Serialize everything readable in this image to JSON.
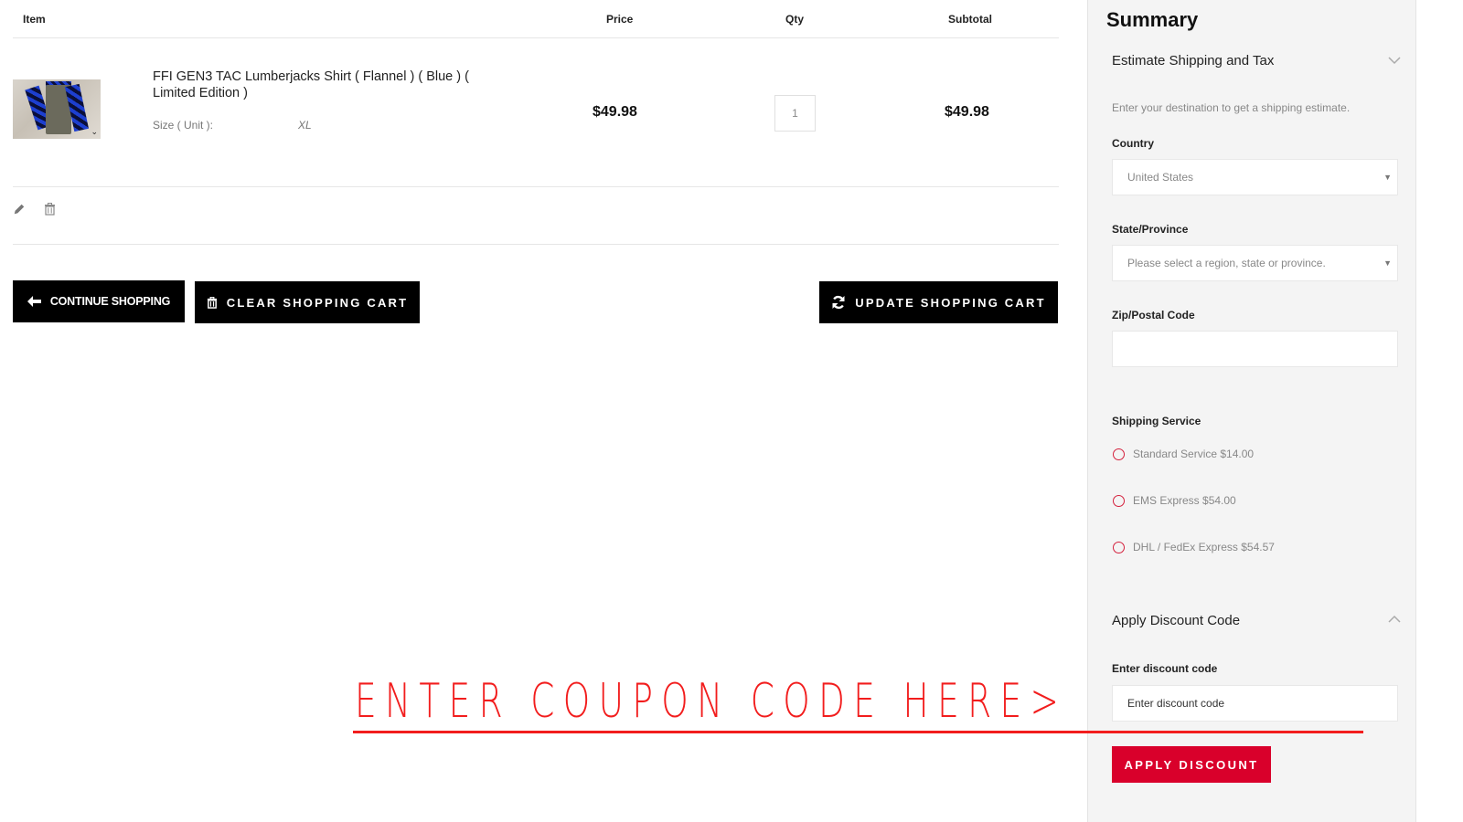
{
  "cart": {
    "headers": {
      "item": "Item",
      "price": "Price",
      "qty": "Qty",
      "subtotal": "Subtotal"
    },
    "items": [
      {
        "name": "FFI GEN3 TAC Lumberjacks Shirt ( Flannel ) ( Blue ) ( Limited Edition )",
        "option_label": "Size ( Unit ):",
        "option_value": "XL",
        "price": "$49.98",
        "qty": "1",
        "subtotal": "$49.98",
        "image_icon": "product-thumbnail"
      }
    ],
    "item_actions": {
      "edit_icon": "pencil-icon",
      "delete_icon": "trash-icon"
    },
    "buttons": {
      "continue": "CONTINUE SHOPPING",
      "clear": "CLEAR SHOPPING CART",
      "update": "UPDATE SHOPPING CART"
    }
  },
  "summary": {
    "title": "Summary",
    "shipping": {
      "title": "Estimate Shipping and Tax",
      "expanded": false,
      "hint": "Enter your destination to get a shipping estimate.",
      "country_label": "Country",
      "country_value": "United States",
      "state_label": "State/Province",
      "state_placeholder": "Please select a region, state or province.",
      "zip_label": "Zip/Postal Code",
      "zip_value": "",
      "service_label": "Shipping Service",
      "services": [
        {
          "label": "Standard Service $14.00",
          "selected": false
        },
        {
          "label": "EMS Express $54.00",
          "selected": false
        },
        {
          "label": "DHL / FedEx Express $54.57",
          "selected": false
        }
      ]
    },
    "discount": {
      "title": "Apply Discount Code",
      "expanded": true,
      "field_label": "Enter discount code",
      "placeholder": "Enter discount code",
      "button": "APPLY DISCOUNT"
    }
  },
  "annotation": {
    "text": "ENTER COUPON CODE HERE>",
    "color": "#f21d1d"
  },
  "colors": {
    "accent": "#d9002b",
    "button_dark": "#000000",
    "sidebar_bg": "#f4f4f4"
  }
}
